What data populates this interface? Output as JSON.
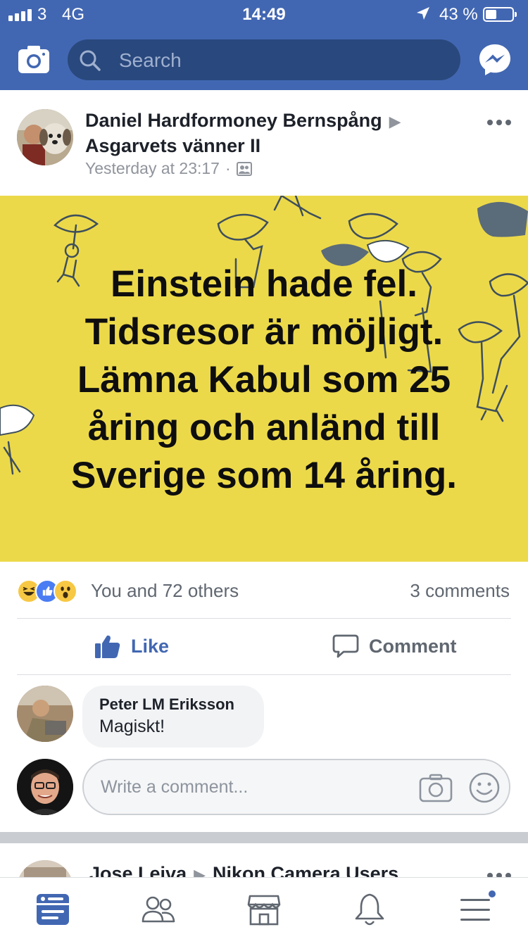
{
  "status_bar": {
    "carrier": "3",
    "network": "4G",
    "time": "14:49",
    "battery_percent": "43 %",
    "battery_level": 0.43
  },
  "nav": {
    "search_placeholder": "Search",
    "camera_icon": "camera-icon",
    "messenger_icon": "messenger-icon"
  },
  "post": {
    "author": "Daniel Hardformoney Bernspång",
    "group": "Asgarvets vänner II",
    "timestamp": "Yesterday at 23:17",
    "separator": "·",
    "privacy_icon": "group-members-icon",
    "image_text_lines": [
      "Einstein hade fel.",
      "Tidsresor är möjligt.",
      "Lämna Kabul som 25",
      "åring och anländ till",
      "Sverige som 14 åring."
    ],
    "image_background": "#ecd94a",
    "reaction_icons": [
      "haha-icon",
      "like-icon",
      "wow-icon"
    ],
    "reactions_label": "You and 72 others",
    "comments_label": "3 comments",
    "like_label": "Like",
    "comment_label": "Comment"
  },
  "comments": [
    {
      "name": "Peter LM Eriksson",
      "text": "Magiskt!"
    }
  ],
  "composer": {
    "placeholder": "Write a comment..."
  },
  "next_post": {
    "author": "Jose Leiva",
    "group": "Nikon Camera Users"
  },
  "tab_bar": {
    "items": [
      "news-feed-icon",
      "friends-icon",
      "marketplace-icon",
      "notifications-icon",
      "menu-icon"
    ],
    "active_index": 0
  },
  "colors": {
    "brand": "#4267b2",
    "search_bg": "#29487d",
    "meta_text": "#90949c"
  }
}
